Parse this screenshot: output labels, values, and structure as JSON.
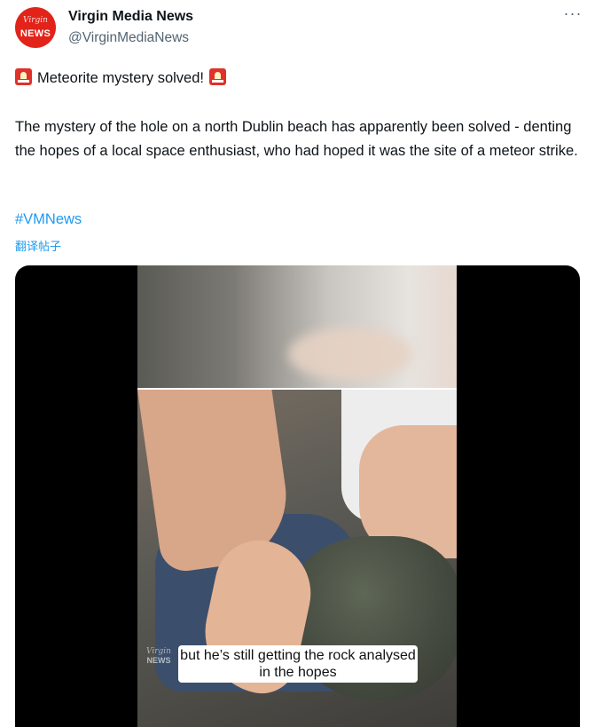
{
  "author": {
    "name": "Virgin Media News",
    "handle": "@VirginMediaNews",
    "avatar_brand": "Virgin",
    "avatar_news": "NEWS"
  },
  "more_icon": "more-horizontal-icon",
  "tweet": {
    "headline_icon": "rotating-light-emoji",
    "headline": "Meteorite mystery solved!",
    "body": "The mystery of the hole on a north Dublin beach has apparently been solved - denting the hopes of a local space enthusiast, who had hoped it was the site of a meteor strike.",
    "hashtag": "#VMNews",
    "translate_label": "翻译帖子"
  },
  "video": {
    "caption": "but he’s still getting the rock analysed in the hopes",
    "watermark_brand": "Virgin",
    "watermark_news": "NEWS"
  },
  "colors": {
    "accent": "#1d9bf0",
    "brand_red": "#e2231a",
    "text": "#0f1419",
    "secondary_text": "#536471"
  }
}
